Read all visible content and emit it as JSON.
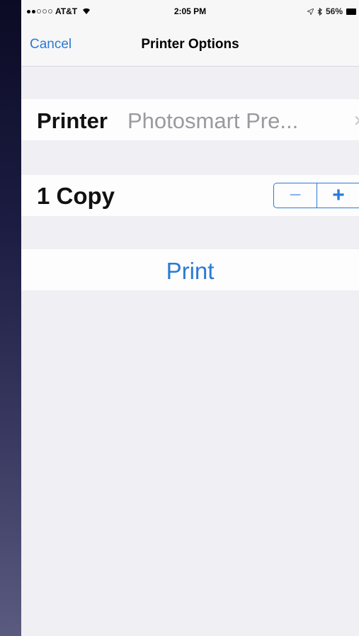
{
  "status_bar": {
    "carrier": "AT&T",
    "time": "2:05 PM",
    "battery": "56%",
    "signal_bars_filled": 2,
    "signal_bars_total": 5,
    "icons": [
      "signal-dots-icon",
      "wifi-icon",
      "location-icon",
      "bluetooth-icon",
      "battery-icon"
    ]
  },
  "nav": {
    "cancel_label": "Cancel",
    "title": "Printer Options"
  },
  "printer_row": {
    "label": "Printer",
    "value": "Photosmart Pre...",
    "chevron": "›"
  },
  "copies_row": {
    "label": "1 Copy",
    "minus": "−",
    "plus": "+"
  },
  "print_button": {
    "label": "Print"
  },
  "colors": {
    "accent": "#2a7ad6",
    "background": "#efeff4",
    "row": "#fdfdfd",
    "secondary_text": "#9a9a9e"
  }
}
